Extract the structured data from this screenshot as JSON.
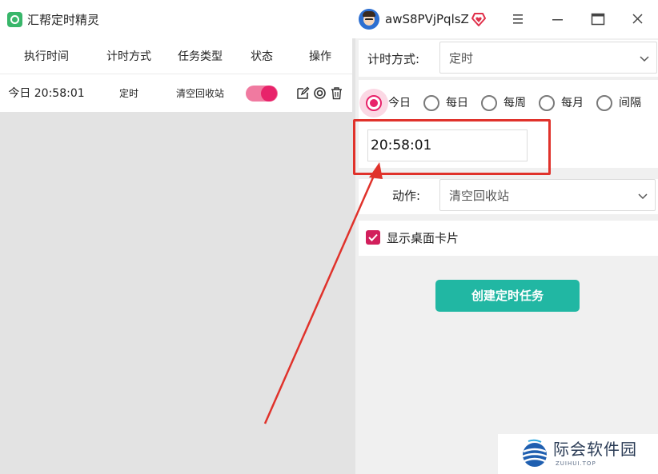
{
  "app": {
    "title": "汇帮定时精灵",
    "username": "awS8PVjPqlsZ",
    "logo_icon": "alarm-clock-icon",
    "vip_icon": "diamond-heart-icon",
    "window_buttons": [
      "menu-icon",
      "minimize-icon",
      "maximize-icon",
      "close-icon"
    ]
  },
  "task_table": {
    "headers": {
      "time": "执行时间",
      "mode": "计时方式",
      "type": "任务类型",
      "status": "状态",
      "ops": "操作"
    },
    "rows": [
      {
        "time": "今日 20:58:01",
        "mode": "定时",
        "type": "清空回收站",
        "enabled": true,
        "op_icons": [
          "edit-icon",
          "view-icon",
          "delete-icon"
        ]
      }
    ]
  },
  "form": {
    "mode_label": "计时方式:",
    "mode_value": "定时",
    "radio_options": [
      {
        "label": "今日",
        "checked": true
      },
      {
        "label": "每日",
        "checked": false
      },
      {
        "label": "每周",
        "checked": false
      },
      {
        "label": "每月",
        "checked": false
      },
      {
        "label": "间隔",
        "checked": false
      }
    ],
    "time_value": "20:58:01",
    "action_label": "动作:",
    "action_value": "清空回收站",
    "show_card_checked": true,
    "show_card_label": "显示桌面卡片",
    "create_button": "创建定时任务"
  },
  "watermark": {
    "text": "际会软件园",
    "sub": "ZUIHUI.TOP"
  },
  "colors": {
    "accent_pink": "#e8236a",
    "button_teal": "#21b7a3",
    "annotation_red": "#e0322b",
    "left_bg": "#e3e3e3",
    "right_bg": "#f0f0f0"
  }
}
